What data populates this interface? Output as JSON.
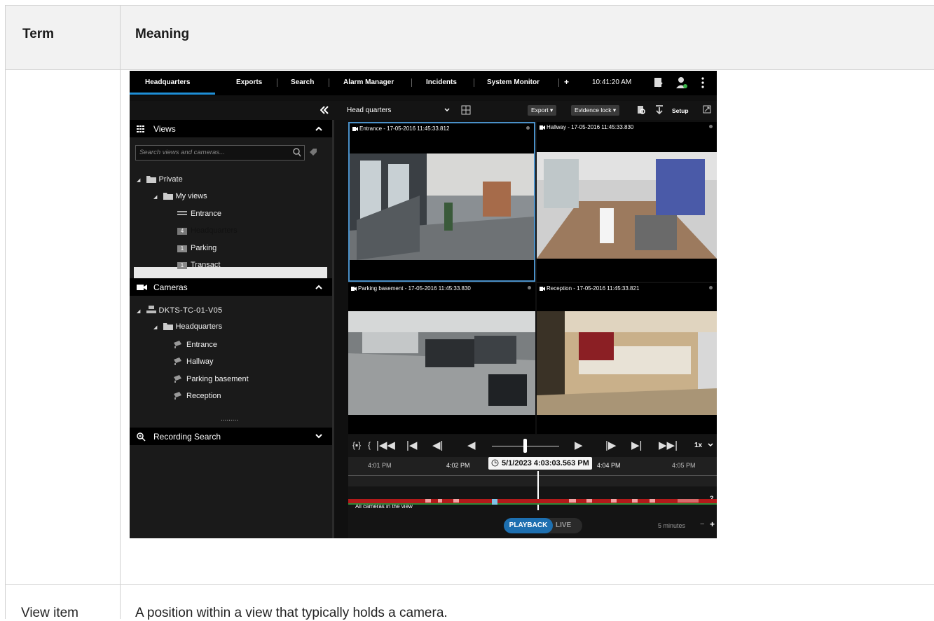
{
  "table": {
    "header_term": "Term",
    "header_meaning": "Meaning",
    "rows": [
      {
        "term": "View item",
        "meaning": "A position within a view that typically holds a camera."
      }
    ]
  },
  "app": {
    "tabs": [
      "Headquarters",
      "Exports",
      "Search",
      "Alarm Manager",
      "Incidents",
      "System Monitor"
    ],
    "add_tab": "+",
    "clock": "10:41:20 AM",
    "view_selector": "Head quarters",
    "export_button": "Export",
    "evidence_lock_button": "Evidence lock",
    "setup_button": "Setup",
    "views_title": "Views",
    "search_placeholder": "Search views and cameras...",
    "private": "Private",
    "my_views": "My views",
    "views": [
      {
        "badge": "",
        "name": "Entrance"
      },
      {
        "badge": "4",
        "name": "Headquarters"
      },
      {
        "badge": "1",
        "name": "Parking"
      },
      {
        "badge": "1",
        "name": "Transact"
      }
    ],
    "cameras_title": "Cameras",
    "server": "DKTS-TC-01-V05",
    "hq_group": "Headquarters",
    "cameras": [
      "Entrance",
      "Hallway",
      "Parking basement",
      "Reception"
    ],
    "more_dots": ".........",
    "recording_search": "Recording Search",
    "feeds": [
      "Entrance - 17-05-2016 11:45:33.812",
      "Hallway - 17-05-2016 11:45:33.830",
      "Parking basement - 17-05-2016 11:45:33.830",
      "Reception - 17-05-2016 11:45:33.821"
    ],
    "speed": "1x",
    "tl_labels": [
      "4:01 PM",
      "4:02 PM",
      "4:04 PM",
      "4:05 PM"
    ],
    "tl_current": "5/1/2023 4:03:03.563 PM",
    "all_cameras": "All cameras in the view",
    "question": "?",
    "playback": "PLAYBACK",
    "live": "LIVE",
    "span": "5 minutes",
    "zoom_minus": "−",
    "zoom_plus": "+"
  }
}
